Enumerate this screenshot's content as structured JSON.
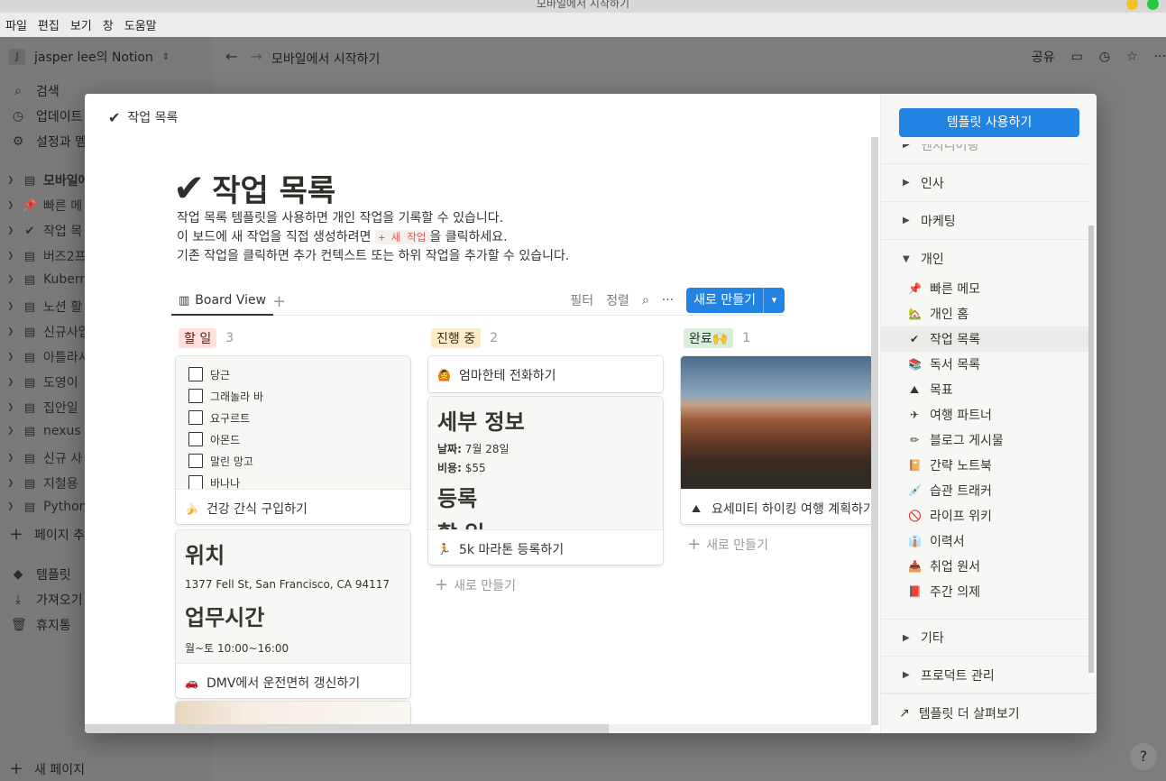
{
  "os": {
    "window_title": "모바일에서 시작하기",
    "menu": [
      "파일",
      "편집",
      "보기",
      "창",
      "도움말"
    ],
    "dot_colors": [
      "#f5bf2e",
      "#27c93f"
    ]
  },
  "sidebar": {
    "workspace_badge": "J",
    "workspace_name": "jasper lee의 Notion",
    "nav": [
      {
        "icon": "search-icon",
        "label": "검색"
      },
      {
        "icon": "clock-icon",
        "label": "업데이트"
      },
      {
        "icon": "gear-icon",
        "label": "설정과 멤"
      }
    ],
    "pages": [
      {
        "icon": "📄",
        "label": "모바일에"
      },
      {
        "icon": "📌",
        "label": "빠른 메"
      },
      {
        "icon": "✔",
        "label": "작업 목"
      },
      {
        "icon": "📄",
        "label": "버즈2프"
      },
      {
        "icon": "📄",
        "label": "Kubern"
      },
      {
        "icon": "📄",
        "label": "노션 활"
      },
      {
        "icon": "📄",
        "label": "신규사업"
      },
      {
        "icon": "📄",
        "label": "아틀라시"
      },
      {
        "icon": "📄",
        "label": "도영이 "
      },
      {
        "icon": "📄",
        "label": "집안일 "
      },
      {
        "icon": "📄",
        "label": "nexus r"
      },
      {
        "icon": "📄",
        "label": "신규 사"
      },
      {
        "icon": "📄",
        "label": "지철용 "
      },
      {
        "icon": "📄",
        "label": "Python"
      }
    ],
    "add_page": "페이지 추가",
    "bottom": [
      {
        "icon": "shapes-icon",
        "label": "템플릿"
      },
      {
        "icon": "download-icon",
        "label": "가져오기"
      },
      {
        "icon": "trash-icon",
        "label": "휴지통"
      }
    ],
    "new_page": "새 페이지"
  },
  "topbar": {
    "breadcrumb": "모바일에서 시작하기",
    "share": "공유"
  },
  "modal": {
    "header_label": "작업 목록",
    "title": "작업 목록",
    "desc_line1": "작업 목록 템플릿을 사용하면 개인 작업을 기록할 수 있습니다.",
    "desc_line2_pre": "이 보드에 새 작업을 직접 생성하려면",
    "desc_line2_code": "+ 새 작업",
    "desc_line2_post": "을 클릭하세요.",
    "desc_line3": "기존 작업을 클릭하면 추가 컨텍스트 또는 하위 작업을 추가할 수 있습니다.",
    "view_tab": "Board View",
    "filter": "필터",
    "sort": "정렬",
    "new_button": "새로 만들기",
    "columns": [
      {
        "name": "할 일",
        "count": "3",
        "bg": "#ffe2dd",
        "fg": "#5d1715"
      },
      {
        "name": "진행 중",
        "count": "2",
        "bg": "#fdecc8",
        "fg": "#402c1b"
      },
      {
        "name": "완료🙌",
        "count": "1",
        "bg": "#dbeddb",
        "fg": "#1c3829"
      }
    ],
    "todo_checklist": [
      "당근",
      "그래놀라 바",
      "요구르트",
      "아몬드",
      "말린 망고",
      "바나나"
    ],
    "card_snack": {
      "emoji": "🍌",
      "title": "건강 간식 구입하기"
    },
    "card_dmv": {
      "h1": "위치",
      "address": "1377 Fell St, San Francisco, CA 94117",
      "h2": "업무시간",
      "hours": "월~토 10:00~16:00",
      "emoji": "🚗",
      "title": "DMV에서 운전면허 갱신하기"
    },
    "card_mom": {
      "emoji": "🙆",
      "title": "엄마한테 전화하기"
    },
    "card_marathon": {
      "h1": "세부 정보",
      "date_label": "날짜:",
      "date_value": "7월 28일",
      "cost_label": "비용:",
      "cost_value": "$55",
      "h2": "등록",
      "h3": "할 일",
      "emoji": "🏃",
      "title": "5k 마라톤 등록하기"
    },
    "card_hike": {
      "emoji": "⛰",
      "title": "요세미티 하이킹 여행 계획하기"
    },
    "add_new": "새로 만들기"
  },
  "templates": {
    "use_button": "템플릿 사용하기",
    "cut_category": "엔지니어링",
    "categories_top": [
      "인사",
      "마케팅"
    ],
    "open_category": "개인",
    "items": [
      {
        "icon": "📌",
        "label": "빠른 메모"
      },
      {
        "icon": "🏡",
        "label": "개인 홈"
      },
      {
        "icon": "✔",
        "label": "작업 목록",
        "selected": true
      },
      {
        "icon": "📚",
        "label": "독서 목록"
      },
      {
        "icon": "⛰",
        "label": "목표"
      },
      {
        "icon": "✈",
        "label": "여행 파트너"
      },
      {
        "icon": "✏",
        "label": "블로그 게시물"
      },
      {
        "icon": "📔",
        "label": "간략 노트북"
      },
      {
        "icon": "💉",
        "label": "습관 트래커"
      },
      {
        "icon": "🚫",
        "label": "라이프 위키"
      },
      {
        "icon": "👔",
        "label": "이력서"
      },
      {
        "icon": "📥",
        "label": "취업 원서"
      },
      {
        "icon": "📕",
        "label": "주간 의제"
      }
    ],
    "categories_bottom": [
      "기타",
      "프로덕트 관리"
    ],
    "more": "템플릿 더 살펴보기"
  }
}
